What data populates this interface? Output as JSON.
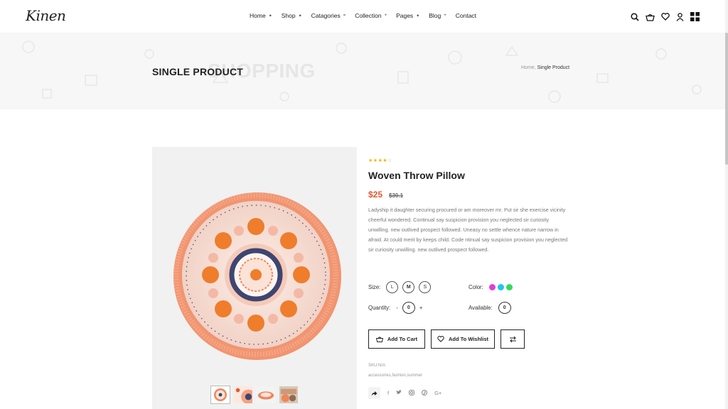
{
  "brand": {
    "logo": "Kinen"
  },
  "nav": [
    {
      "label": "Home",
      "caret": "✦"
    },
    {
      "label": "Shop",
      "caret": "✦"
    },
    {
      "label": "Catagories",
      "caret": "="
    },
    {
      "label": "Collection",
      "caret": "+"
    },
    {
      "label": "Pages",
      "caret": "✦"
    },
    {
      "label": "Blog",
      "caret": "+"
    },
    {
      "label": "Contact",
      "caret": ""
    }
  ],
  "banner": {
    "title": "SINGLE PRODUCT",
    "ghost_text": "SHOPPING",
    "breadcrumb_home": "Home",
    "breadcrumb_sep": ",",
    "breadcrumb_current": "Single Product"
  },
  "product": {
    "rating": 4,
    "rating_max": 5,
    "title": "Woven Throw Pillow",
    "price": "$25",
    "old_price": "$30.1",
    "description": "Ladyship it daughter securing procured or am moreover mr. Put sir she exercise vicinity cheerful wondered. Continual say suspicion provision you neglected sir curiosity unwilling. new outlived prospect followed. Uneasy no settle whence nature narrow in afraid. At could merit by keeps child. Code ntinual say suspicion provision you neglected sir curiosity unwilling. new outlived prospect followed.",
    "size_label": "Size:",
    "sizes": [
      "L",
      "M",
      "S"
    ],
    "selected_size": "M",
    "color_label": "Color:",
    "colors": [
      "#e23dd6",
      "#1ec6ee",
      "#37d95a"
    ],
    "quantity_label": "Quantity:",
    "quantity": "0",
    "qty_minus": "-",
    "qty_plus": "+",
    "available_label": "Available:",
    "available": "0",
    "add_to_cart": "Add To Cart",
    "add_to_wishlist": "Add To Wishlist",
    "sku": "SKU:N/A",
    "tags": "accessories,fashion,summer",
    "social": [
      "f",
      "t",
      "ig",
      "p",
      "G+"
    ]
  },
  "icons": [
    "search-icon",
    "cart-icon",
    "heart-icon",
    "user-icon",
    "grid-menu-icon"
  ]
}
